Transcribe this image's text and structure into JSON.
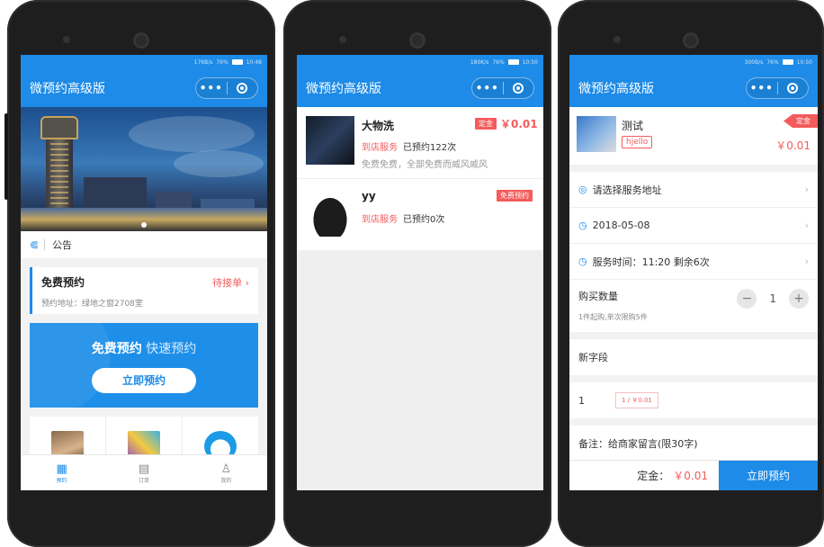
{
  "app": {
    "title": "微预约高级版"
  },
  "status": {
    "screen1": {
      "speed": "176B/s",
      "battery": "76%",
      "time": "10:48"
    },
    "screen2": {
      "speed": "180K/s",
      "battery": "76%",
      "time": "10:50"
    },
    "screen3": {
      "speed": "300B/s",
      "battery": "76%",
      "time": "10:50"
    }
  },
  "screen1": {
    "notice_label": "公告",
    "booking_card": {
      "title": "免费预约",
      "status": "待接单 ›",
      "address": "预约地址：绿地之窗2708室"
    },
    "promo": {
      "bold": "免费预约",
      "light": "快速预约",
      "button": "立即预约"
    },
    "tabs": [
      {
        "label": "预约",
        "icon": "calendar-icon"
      },
      {
        "label": "订单",
        "icon": "order-icon"
      },
      {
        "label": "我的",
        "icon": "user-icon"
      }
    ]
  },
  "screen2": {
    "items": [
      {
        "name": "大物洗",
        "tag": "定金",
        "price": "￥0.01",
        "service": "到店服务",
        "booked": "已预约122次",
        "desc": "免费免费，全部免费而威风威风"
      },
      {
        "name": "yy",
        "tag": "免费预约",
        "service": "到店服务",
        "booked": "已预约0次"
      }
    ]
  },
  "screen3": {
    "product": {
      "name": "测试",
      "chip": "hjello",
      "ribbon": "定金",
      "price": "￥0.01"
    },
    "address": "请选择服务地址",
    "date": "2018-05-08",
    "time": "服务时间：11:20 剩余6次",
    "quantity": {
      "label": "购买数量",
      "hint": "1件起购,单次限购5件",
      "value": "1",
      "minus": "−",
      "plus": "+"
    },
    "new_field": "新字段",
    "option_row": {
      "index": "1",
      "option": "1 / ￥0.01"
    },
    "remark": "备注：给商家留言(限30字)",
    "footer": {
      "deposit_label": "定金：",
      "deposit_value": "￥0.01",
      "submit": "立即预约"
    }
  }
}
